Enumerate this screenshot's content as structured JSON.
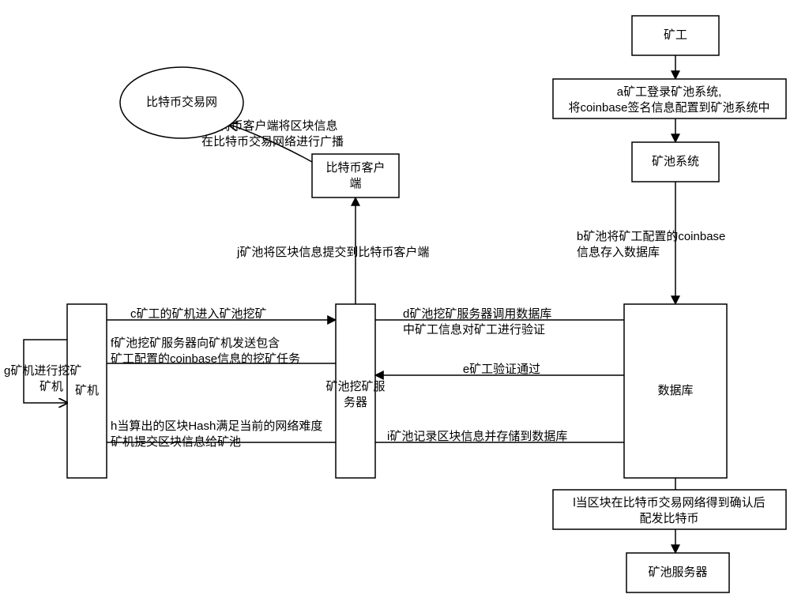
{
  "nodes": {
    "miner": "矿工",
    "pool_system": "矿池系统",
    "database": "数据库",
    "pool_server": "矿池服务器",
    "btc_client_l1": "比特币客户",
    "btc_client_l2": "端",
    "btc_net": "比特币交易网",
    "mining_machine": "矿机",
    "mining_server_l1": "矿池挖矿服",
    "mining_server_l2": "务器",
    "g_label_l1": "g矿机进行挖矿",
    "g_label_l2": "矿机"
  },
  "edges": {
    "a_l1": "a矿工登录矿池系统,",
    "a_l2": "将coinbase签名信息配置到矿池系统中",
    "b_l1": "b矿池将矿工配置的coinbase",
    "b_l2": "信息存入数据库",
    "c": "c矿工的矿机进入矿池挖矿",
    "d_l1": "d矿池挖矿服务器调用数据库",
    "d_l2": "中矿工信息对矿工进行验证",
    "e": "e矿工验证通过",
    "f_l1": "f矿池挖矿服务器向矿机发送包含",
    "f_l2": "矿工配置的coinbase信息的挖矿任务",
    "h_l1": "h当算出的区块Hash满足当前的网络难度",
    "h_l2": "矿机提交区块信息给矿池",
    "i": "i矿池记录区块信息并存储到数据库",
    "j": "j矿池将区块信息提交到比特币客户端",
    "k_l1": "k比特币客户端将区块信息",
    "k_l2": "在比特币交易网络进行广播",
    "l_l1": "l当区块在比特币交易网络得到确认后",
    "l_l2": "配发比特币"
  },
  "chart_data": {
    "type": "diagram",
    "title": "",
    "nodes": [
      {
        "id": "miner",
        "label": "矿工"
      },
      {
        "id": "pool_system",
        "label": "矿池系统"
      },
      {
        "id": "database",
        "label": "数据库"
      },
      {
        "id": "pool_server",
        "label": "矿池服务器"
      },
      {
        "id": "btc_client",
        "label": "比特币客户端"
      },
      {
        "id": "btc_net",
        "label": "比特币交易网"
      },
      {
        "id": "mining_machine",
        "label": "矿机"
      },
      {
        "id": "mining_server",
        "label": "矿池挖矿服务器"
      }
    ],
    "edges": [
      {
        "id": "a",
        "from": "miner",
        "to": "pool_system",
        "label": "a矿工登录矿池系统,将coinbase签名信息配置到矿池系统中"
      },
      {
        "id": "b",
        "from": "pool_system",
        "to": "database",
        "label": "b矿池将矿工配置的coinbase信息存入数据库"
      },
      {
        "id": "c",
        "from": "mining_machine",
        "to": "mining_server",
        "label": "c矿工的矿机进入矿池挖矿"
      },
      {
        "id": "d",
        "from": "mining_server",
        "to": "database",
        "label": "d矿池挖矿服务器调用数据库中矿工信息对矿工进行验证"
      },
      {
        "id": "e",
        "from": "database",
        "to": "mining_server",
        "label": "e矿工验证通过"
      },
      {
        "id": "f",
        "from": "mining_server",
        "to": "mining_machine",
        "label": "f矿池挖矿服务器向矿机发送包含矿工配置的coinbase信息的挖矿任务"
      },
      {
        "id": "g",
        "from": "mining_machine",
        "to": "mining_machine",
        "label": "g矿机进行挖矿"
      },
      {
        "id": "h",
        "from": "mining_machine",
        "to": "mining_server",
        "label": "h当算出的区块Hash满足当前的网络难度 矿机提交区块信息给矿池"
      },
      {
        "id": "i",
        "from": "mining_server",
        "to": "database",
        "label": "i矿池记录区块信息并存储到数据库"
      },
      {
        "id": "j",
        "from": "mining_server",
        "to": "btc_client",
        "label": "j矿池将区块信息提交到比特币客户端"
      },
      {
        "id": "k",
        "from": "btc_client",
        "to": "btc_net",
        "label": "k比特币客户端将区块信息在比特币交易网络进行广播"
      },
      {
        "id": "l",
        "from": "database",
        "to": "pool_server",
        "label": "l当区块在比特币交易网络得到确认后配发比特币"
      }
    ]
  }
}
